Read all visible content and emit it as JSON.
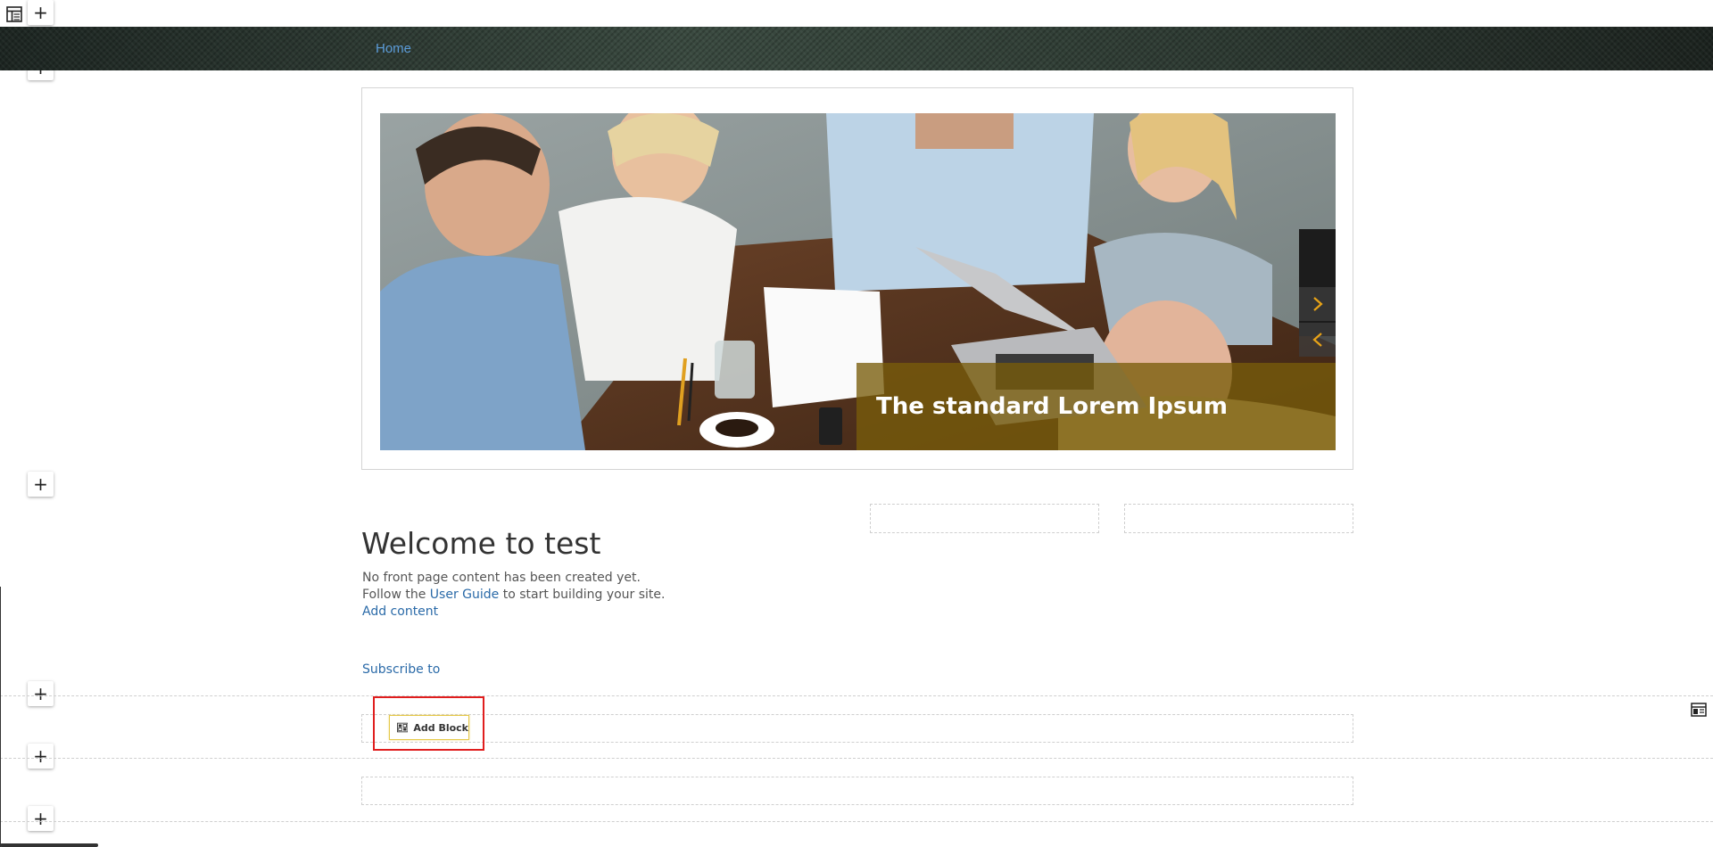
{
  "toolbar": {
    "layout_icon": "layout-icon",
    "plus_symbol": "+"
  },
  "nav": {
    "home_label": "Home"
  },
  "slider": {
    "caption": "The standard Lorem Ipsum",
    "next_icon": "chevron-right-icon",
    "prev_icon": "chevron-left-icon",
    "arrow_color": "#e8a317"
  },
  "main": {
    "title": "Welcome to test",
    "line1": "No front page content has been created yet.",
    "line2_prefix": "Follow the",
    "user_guide_link": "User Guide",
    "line2_suffix": "to start building your site.",
    "add_content_link": "Add content",
    "subscribe_link": "Subscribe to"
  },
  "block_editor": {
    "add_block_label": "Add Block",
    "add_block_icon": "block-grid-icon",
    "side_panel_icon": "panel-icon"
  },
  "colors": {
    "link": "#2a6aa8",
    "nav_link": "#5b9bd8",
    "highlight": "#e01e1e",
    "add_block_border": "#e6c94a"
  }
}
